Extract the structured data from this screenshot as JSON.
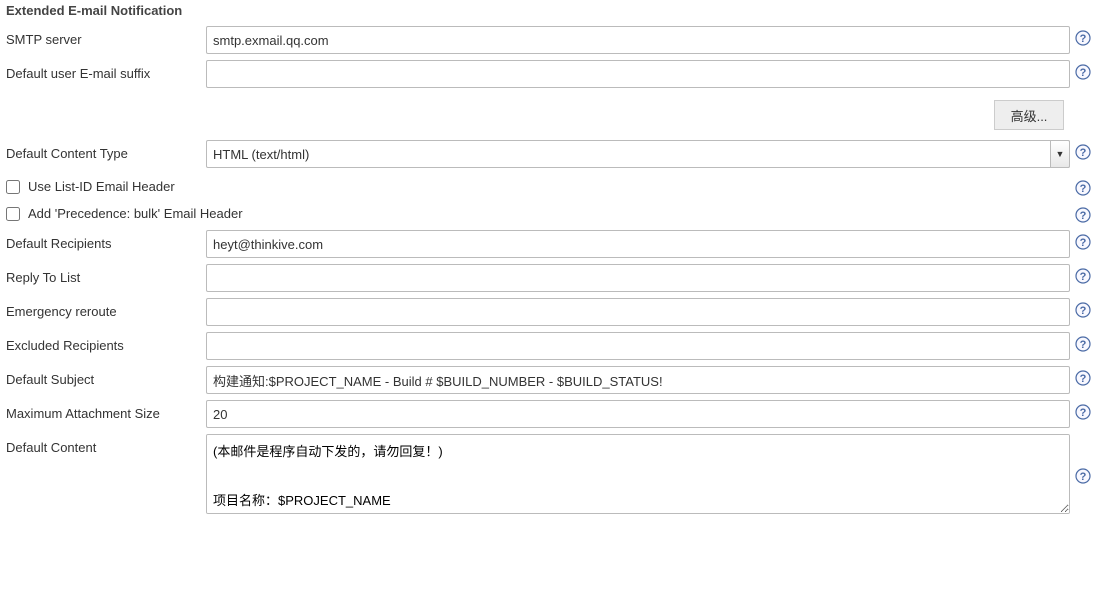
{
  "section_title": "Extended E-mail Notification",
  "fields": {
    "smtp_server": {
      "label": "SMTP server",
      "value": "smtp.exmail.qq.com"
    },
    "suffix": {
      "label": "Default user E-mail suffix",
      "value": ""
    },
    "advanced_button": "高级...",
    "content_type": {
      "label": "Default Content Type",
      "selected": "HTML (text/html)"
    },
    "use_list_id": {
      "label": "Use List-ID Email Header",
      "checked": false
    },
    "add_precedence": {
      "label": "Add 'Precedence: bulk' Email Header",
      "checked": false
    },
    "default_recipients": {
      "label": "Default Recipients",
      "value": "heyt@thinkive.com"
    },
    "reply_to": {
      "label": "Reply To List",
      "value": ""
    },
    "emergency": {
      "label": "Emergency reroute",
      "value": ""
    },
    "excluded": {
      "label": "Excluded Recipients",
      "value": ""
    },
    "default_subject": {
      "label": "Default Subject",
      "value": "构建通知:$PROJECT_NAME - Build # $BUILD_NUMBER - $BUILD_STATUS!"
    },
    "max_attach": {
      "label": "Maximum Attachment Size",
      "value": "20"
    },
    "default_content": {
      "label": "Default Content",
      "value": "(本邮件是程序自动下发的，请勿回复！)\n\n项目名称：$PROJECT_NAME"
    }
  }
}
